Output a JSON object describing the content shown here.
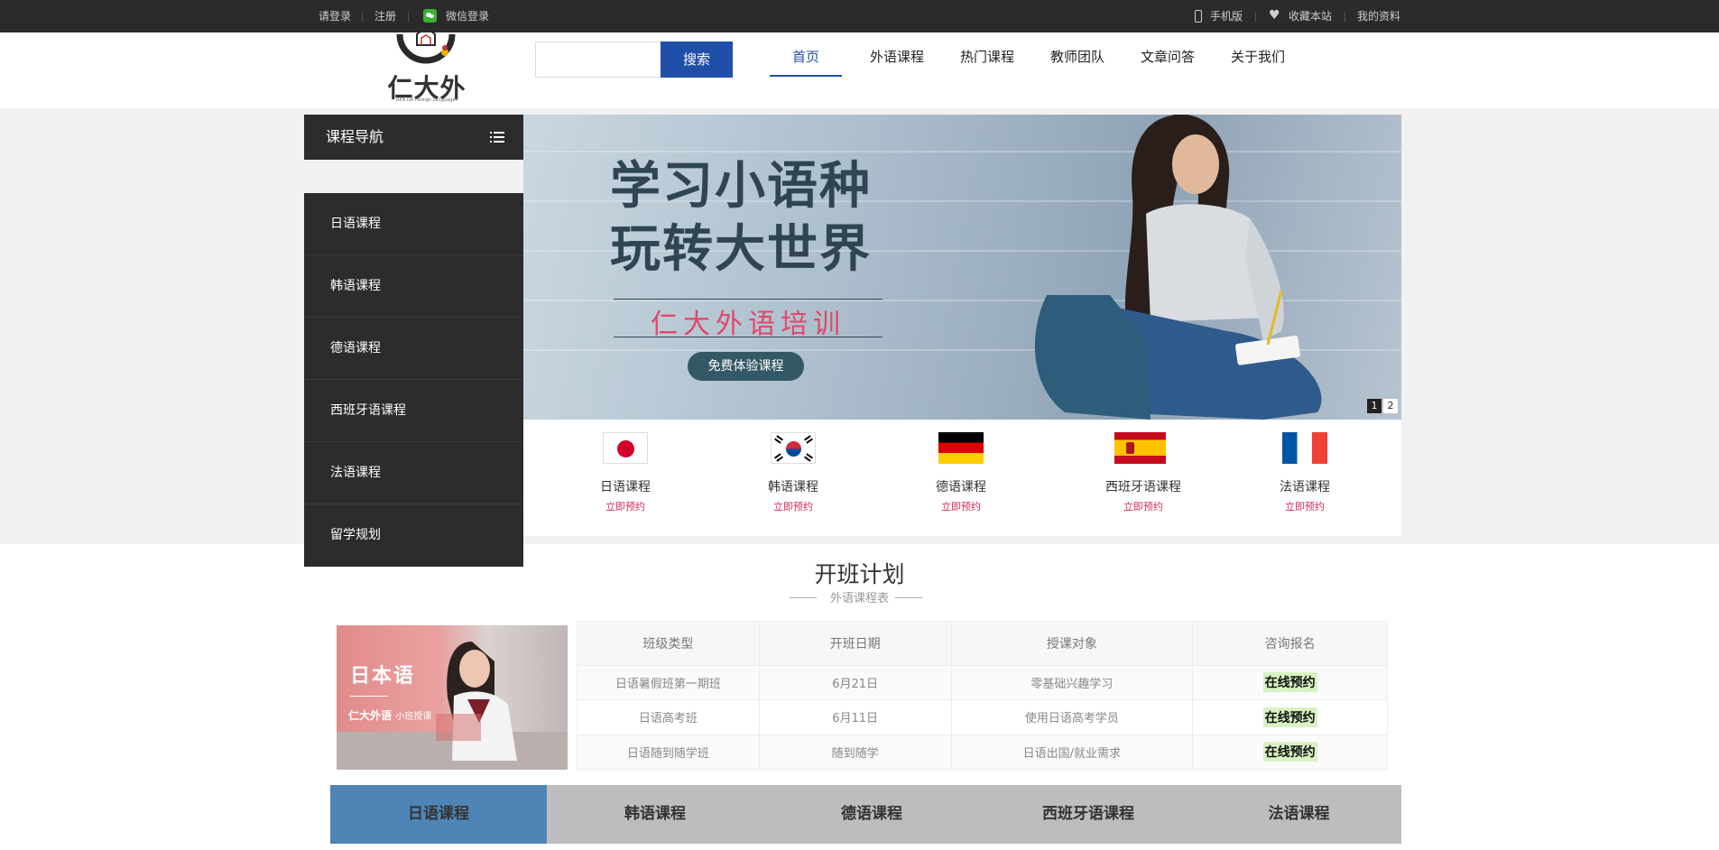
{
  "topbar": {
    "login": "请登录",
    "register": "注册",
    "wechat_login": "微信登录",
    "mobile": "手机版",
    "favorite": "收藏本站",
    "my_profile": "我的资料"
  },
  "header": {
    "logo_text": "仁大外语",
    "logo_sub": "REN DA Foreign Languages",
    "search_placeholder": "",
    "search_button": "搜索",
    "nav": [
      "首页",
      "外语课程",
      "热门课程",
      "教师团队",
      "文章问答",
      "关于我们"
    ],
    "active_nav": "首页"
  },
  "sidebar": {
    "title": "课程导航",
    "items": [
      "日语课程",
      "韩语课程",
      "德语课程",
      "西班牙语课程",
      "法语课程",
      "留学规划"
    ]
  },
  "banner": {
    "line1": "学习小语种",
    "line2": "玩转大世界",
    "brand": "仁大外语培训",
    "cta": "免费体验课程",
    "pages": [
      "1",
      "2"
    ],
    "current_page": "1"
  },
  "flags": [
    {
      "name": "日语课程",
      "action": "立即预约",
      "icon": "japan-flag"
    },
    {
      "name": "韩语课程",
      "action": "立即预约",
      "icon": "korea-flag"
    },
    {
      "name": "德语课程",
      "action": "立即预约",
      "icon": "germany-flag"
    },
    {
      "name": "西班牙语课程",
      "action": "立即预约",
      "icon": "spain-flag"
    },
    {
      "name": "法语课程",
      "action": "立即预约",
      "icon": "france-flag"
    }
  ],
  "schedule": {
    "title": "开班计划",
    "subtitle": "外语课程表",
    "promo": {
      "title": "日本语",
      "brand": "仁大外语",
      "brand_small": "小班授课"
    },
    "headers": [
      "班级类型",
      "开班日期",
      "授课对象",
      "咨询报名"
    ],
    "rows": [
      [
        "日语暑假班第一期班",
        "6月21日",
        "零基础兴趣学习",
        "在线预约"
      ],
      [
        "日语高考班",
        "6月11日",
        "使用日语高考学员",
        "在线预约"
      ],
      [
        "日语随到随学班",
        "随到随学",
        "日语出国/就业需求",
        "在线预约"
      ]
    ]
  },
  "tabs": {
    "items": [
      "日语课程",
      "韩语课程",
      "德语课程",
      "西班牙语课程",
      "法语课程"
    ],
    "active": "日语课程"
  },
  "colors": {
    "topbar_bg": "#2b2b2b",
    "brand_blue": "#1f4fa8",
    "sidebar_bg": "#2c2c2c",
    "book_red": "#d62b57",
    "enroll_green": "#d9f2c2",
    "tab_active": "#4f85b6",
    "tab_bg": "#bdbdbd"
  }
}
